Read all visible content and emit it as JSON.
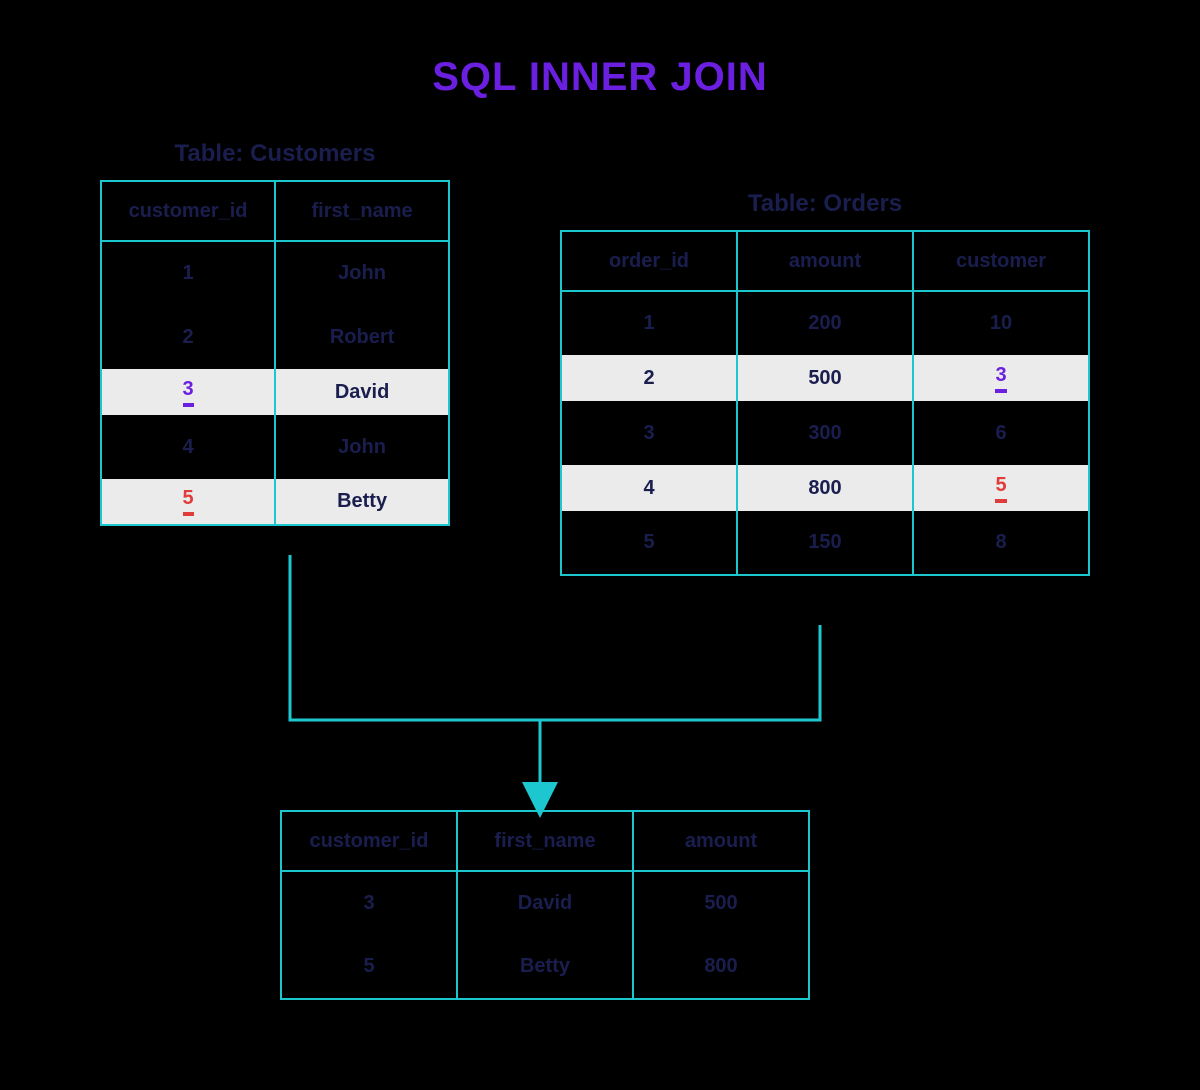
{
  "title": "SQL INNER JOIN",
  "customers": {
    "label": "Table: Customers",
    "headers": [
      "customer_id",
      "first_name"
    ],
    "rows": [
      {
        "cells": [
          "1",
          "John"
        ],
        "hl": false
      },
      {
        "cells": [
          "2",
          "Robert"
        ],
        "hl": false
      },
      {
        "cells": [
          "3",
          "David"
        ],
        "hl": true,
        "keycol": 0,
        "keycolor": "purple"
      },
      {
        "cells": [
          "4",
          "John"
        ],
        "hl": false
      },
      {
        "cells": [
          "5",
          "Betty"
        ],
        "hl": true,
        "keycol": 0,
        "keycolor": "red"
      }
    ]
  },
  "orders": {
    "label": "Table: Orders",
    "headers": [
      "order_id",
      "amount",
      "customer"
    ],
    "rows": [
      {
        "cells": [
          "1",
          "200",
          "10"
        ],
        "hl": false
      },
      {
        "cells": [
          "2",
          "500",
          "3"
        ],
        "hl": true,
        "keycol": 2,
        "keycolor": "purple"
      },
      {
        "cells": [
          "3",
          "300",
          "6"
        ],
        "hl": false
      },
      {
        "cells": [
          "4",
          "800",
          "5"
        ],
        "hl": true,
        "keycol": 2,
        "keycolor": "red"
      },
      {
        "cells": [
          "5",
          "150",
          "8"
        ],
        "hl": false
      }
    ]
  },
  "result": {
    "headers": [
      "customer_id",
      "first_name",
      "amount"
    ],
    "rows": [
      {
        "cells": [
          "3",
          "David",
          "500"
        ]
      },
      {
        "cells": [
          "5",
          "Betty",
          "800"
        ]
      }
    ]
  },
  "colors": {
    "accent": "#1CC7D0",
    "text": "#1A1E4E",
    "purple": "#6B1FE0",
    "red": "#E03C3C"
  }
}
